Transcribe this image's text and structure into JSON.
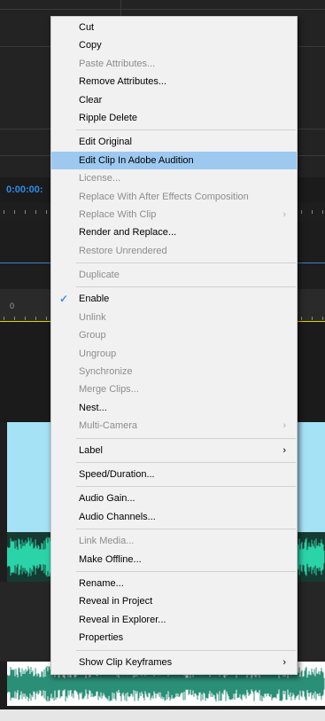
{
  "timeline": {
    "timecode": "0:00:00:",
    "ruler_zero": "0"
  },
  "menu": {
    "groups": [
      [
        {
          "label": "Cut",
          "enabled": true
        },
        {
          "label": "Copy",
          "enabled": true
        },
        {
          "label": "Paste Attributes...",
          "enabled": false
        },
        {
          "label": "Remove Attributes...",
          "enabled": true
        },
        {
          "label": "Clear",
          "enabled": true
        },
        {
          "label": "Ripple Delete",
          "enabled": true
        }
      ],
      [
        {
          "label": "Edit Original",
          "enabled": true
        },
        {
          "label": "Edit Clip In Adobe Audition",
          "enabled": true,
          "highlighted": true
        },
        {
          "label": "License...",
          "enabled": false
        },
        {
          "label": "Replace With After Effects Composition",
          "enabled": false
        },
        {
          "label": "Replace With Clip",
          "enabled": false,
          "submenu": true
        },
        {
          "label": "Render and Replace...",
          "enabled": true
        },
        {
          "label": "Restore Unrendered",
          "enabled": false
        }
      ],
      [
        {
          "label": "Duplicate",
          "enabled": false
        }
      ],
      [
        {
          "label": "Enable",
          "enabled": true,
          "checked": true
        },
        {
          "label": "Unlink",
          "enabled": false
        },
        {
          "label": "Group",
          "enabled": false
        },
        {
          "label": "Ungroup",
          "enabled": false
        },
        {
          "label": "Synchronize",
          "enabled": false
        },
        {
          "label": "Merge Clips...",
          "enabled": false
        },
        {
          "label": "Nest...",
          "enabled": true
        },
        {
          "label": "Multi-Camera",
          "enabled": false,
          "submenu": true
        }
      ],
      [
        {
          "label": "Label",
          "enabled": true,
          "submenu": true
        }
      ],
      [
        {
          "label": "Speed/Duration...",
          "enabled": true
        }
      ],
      [
        {
          "label": "Audio Gain...",
          "enabled": true
        },
        {
          "label": "Audio Channels...",
          "enabled": true
        }
      ],
      [
        {
          "label": "Link Media...",
          "enabled": false
        },
        {
          "label": "Make Offline...",
          "enabled": true
        }
      ],
      [
        {
          "label": "Rename...",
          "enabled": true
        },
        {
          "label": "Reveal in Project",
          "enabled": true
        },
        {
          "label": "Reveal in Explorer...",
          "enabled": true
        },
        {
          "label": "Properties",
          "enabled": true
        }
      ],
      [
        {
          "label": "Show Clip Keyframes",
          "enabled": true,
          "submenu": true
        }
      ]
    ],
    "check_glyph": "✓",
    "submenu_glyph": "›"
  },
  "colors": {
    "menu_bg": "#f1f1f1",
    "highlight": "#9dc9f1",
    "timecode": "#2d8ceb",
    "clip_cyan": "#a6e2f6",
    "waveform": "#2bd4a8"
  }
}
